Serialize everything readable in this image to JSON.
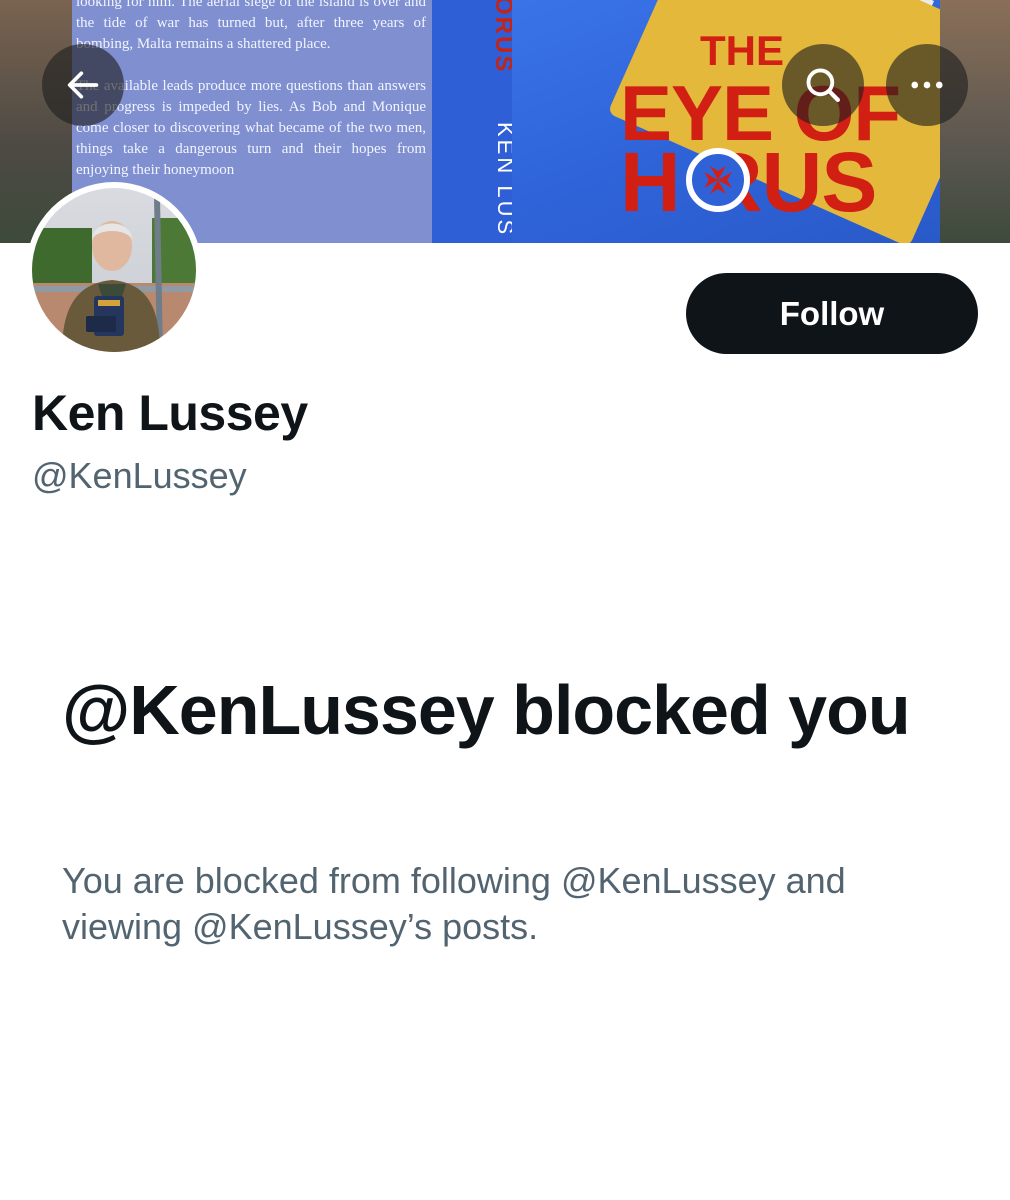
{
  "banner": {
    "back_cover_text": "looking for him. The aerial siege of the island is over and the tide of war has turned but, after three years of bombing, Malta remains a shattered place.\n\nThe available leads produce more questions than answers and progress is impeded by lies. As Bob and Monique come closer to discovering what became of the two men, things take a dangerous turn and their hopes from enjoying their honeymoon",
    "spine_title": "ORUS",
    "spine_author": "KEN LUS",
    "cover_title_line1": "THE",
    "cover_title_line2": "EYE OF",
    "cover_title_line3": "H RUS"
  },
  "nav": {
    "back_icon": "arrow-left-icon",
    "search_icon": "search-icon",
    "more_icon": "more-horizontal-icon"
  },
  "profile": {
    "display_name": "Ken Lussey",
    "handle": "@KenLussey",
    "follow_label": "Follow"
  },
  "blocked": {
    "title": "@KenLussey blocked you",
    "description": "You are blocked from following @KenLussey and viewing @KenLussey’s posts."
  }
}
